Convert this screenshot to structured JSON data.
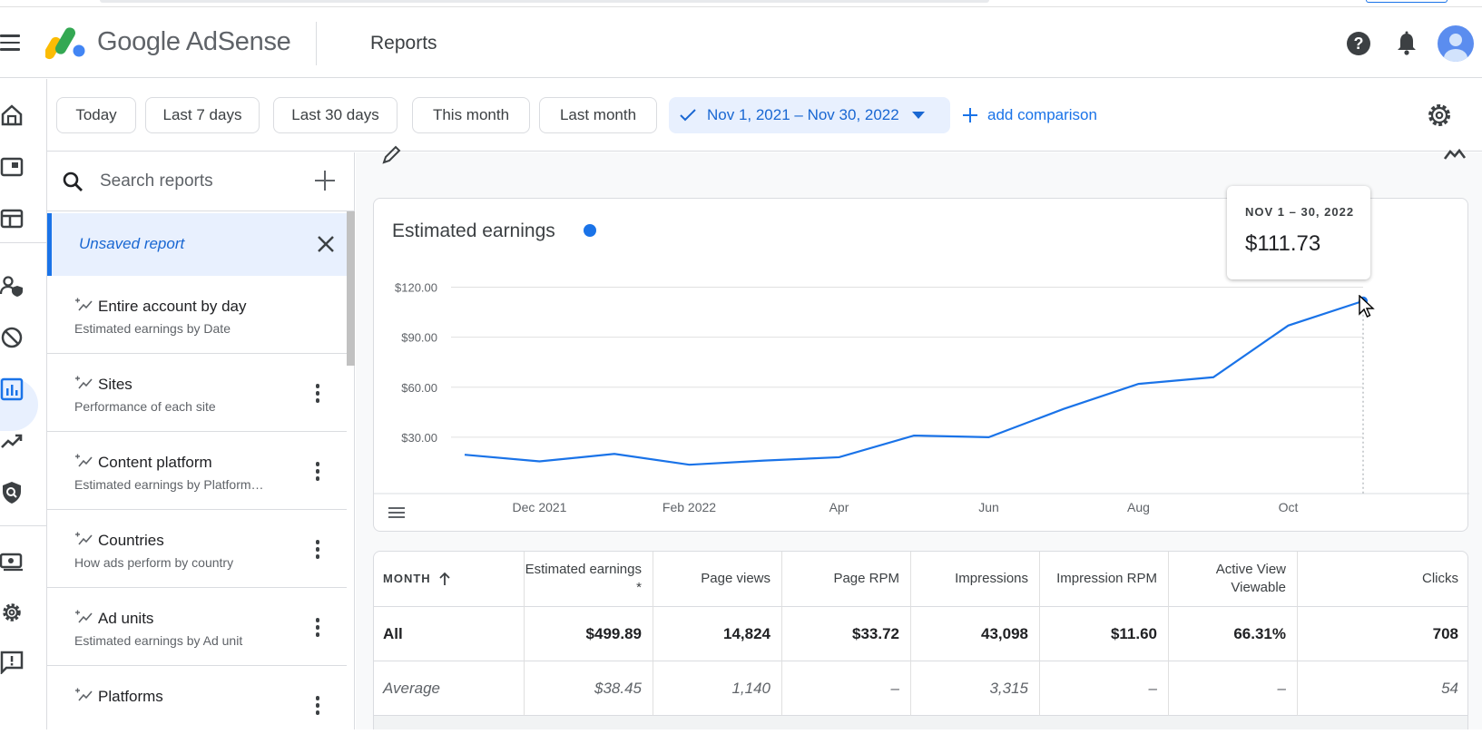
{
  "header": {
    "brand": "Google AdSense",
    "page_title": "Reports"
  },
  "filters": {
    "chips": [
      "Today",
      "Last 7 days",
      "Last 30 days",
      "This month",
      "Last month"
    ],
    "date_range": "Nov 1, 2021 – Nov 30, 2022",
    "add_comparison": "add comparison"
  },
  "report_list": {
    "search_placeholder": "Search reports",
    "unsaved_label": "Unsaved report",
    "items": [
      {
        "title": "Entire account by day",
        "desc": "Estimated earnings by Date"
      },
      {
        "title": "Sites",
        "desc": "Performance of each site"
      },
      {
        "title": "Content platform",
        "desc": "Estimated earnings by Platform…"
      },
      {
        "title": "Countries",
        "desc": "How ads perform by country"
      },
      {
        "title": "Ad units",
        "desc": "Estimated earnings by Ad unit"
      },
      {
        "title": "Platforms",
        "desc": ""
      }
    ]
  },
  "chart_data": {
    "type": "line",
    "title": "Estimated earnings",
    "series_color": "#1a73e8",
    "x": [
      "Nov 2021",
      "Dec 2021",
      "Jan 2022",
      "Feb 2022",
      "Mar 2022",
      "Apr 2022",
      "May 2022",
      "Jun 2022",
      "Jul 2022",
      "Aug 2022",
      "Sep 2022",
      "Oct 2022",
      "Nov 2022"
    ],
    "x_tick_labels": [
      "Dec 2021",
      "Feb 2022",
      "Apr",
      "Jun",
      "Aug",
      "Oct"
    ],
    "x_tick_index": [
      1,
      3,
      5,
      7,
      9,
      11
    ],
    "values": [
      19.5,
      15.5,
      20,
      13.5,
      16,
      18,
      31,
      30,
      47,
      62,
      66,
      97,
      111.73
    ],
    "y_ticks": [
      30,
      60,
      90,
      120
    ],
    "y_tick_labels": [
      "$30.00",
      "$60.00",
      "$90.00",
      "$120.00"
    ],
    "ylim": [
      0,
      135
    ],
    "grid": true
  },
  "tooltip": {
    "date": "NOV 1 – 30, 2022",
    "value": "$111.73"
  },
  "table": {
    "headers": [
      "MONTH",
      "Estimated earnings *",
      "Page views",
      "Page RPM",
      "Impressions",
      "Impression RPM",
      "Active View Viewable",
      "Clicks"
    ],
    "rows": [
      {
        "label": "All",
        "values": [
          "$499.89",
          "14,824",
          "$33.72",
          "43,098",
          "$11.60",
          "66.31%",
          "708"
        ]
      },
      {
        "label": "Average",
        "values": [
          "$38.45",
          "1,140",
          "–",
          "3,315",
          "–",
          "–",
          "54"
        ]
      }
    ]
  },
  "colors": {
    "accent": "#1a73e8",
    "active_bg": "#e8f0fe"
  }
}
